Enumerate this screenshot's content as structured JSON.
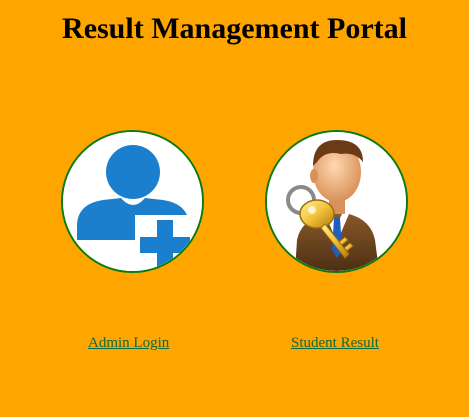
{
  "header": {
    "title": "Result Management Portal"
  },
  "admin": {
    "icon": "admin-user-plus-icon",
    "link_label": "Admin Login"
  },
  "student": {
    "icon": "student-key-icon",
    "link_label": "Student Result"
  },
  "colors": {
    "background": "#FFA500",
    "circle_border": "#0a7a12",
    "link": "#0b6b3a",
    "admin_icon_blue": "#1b7fce"
  }
}
